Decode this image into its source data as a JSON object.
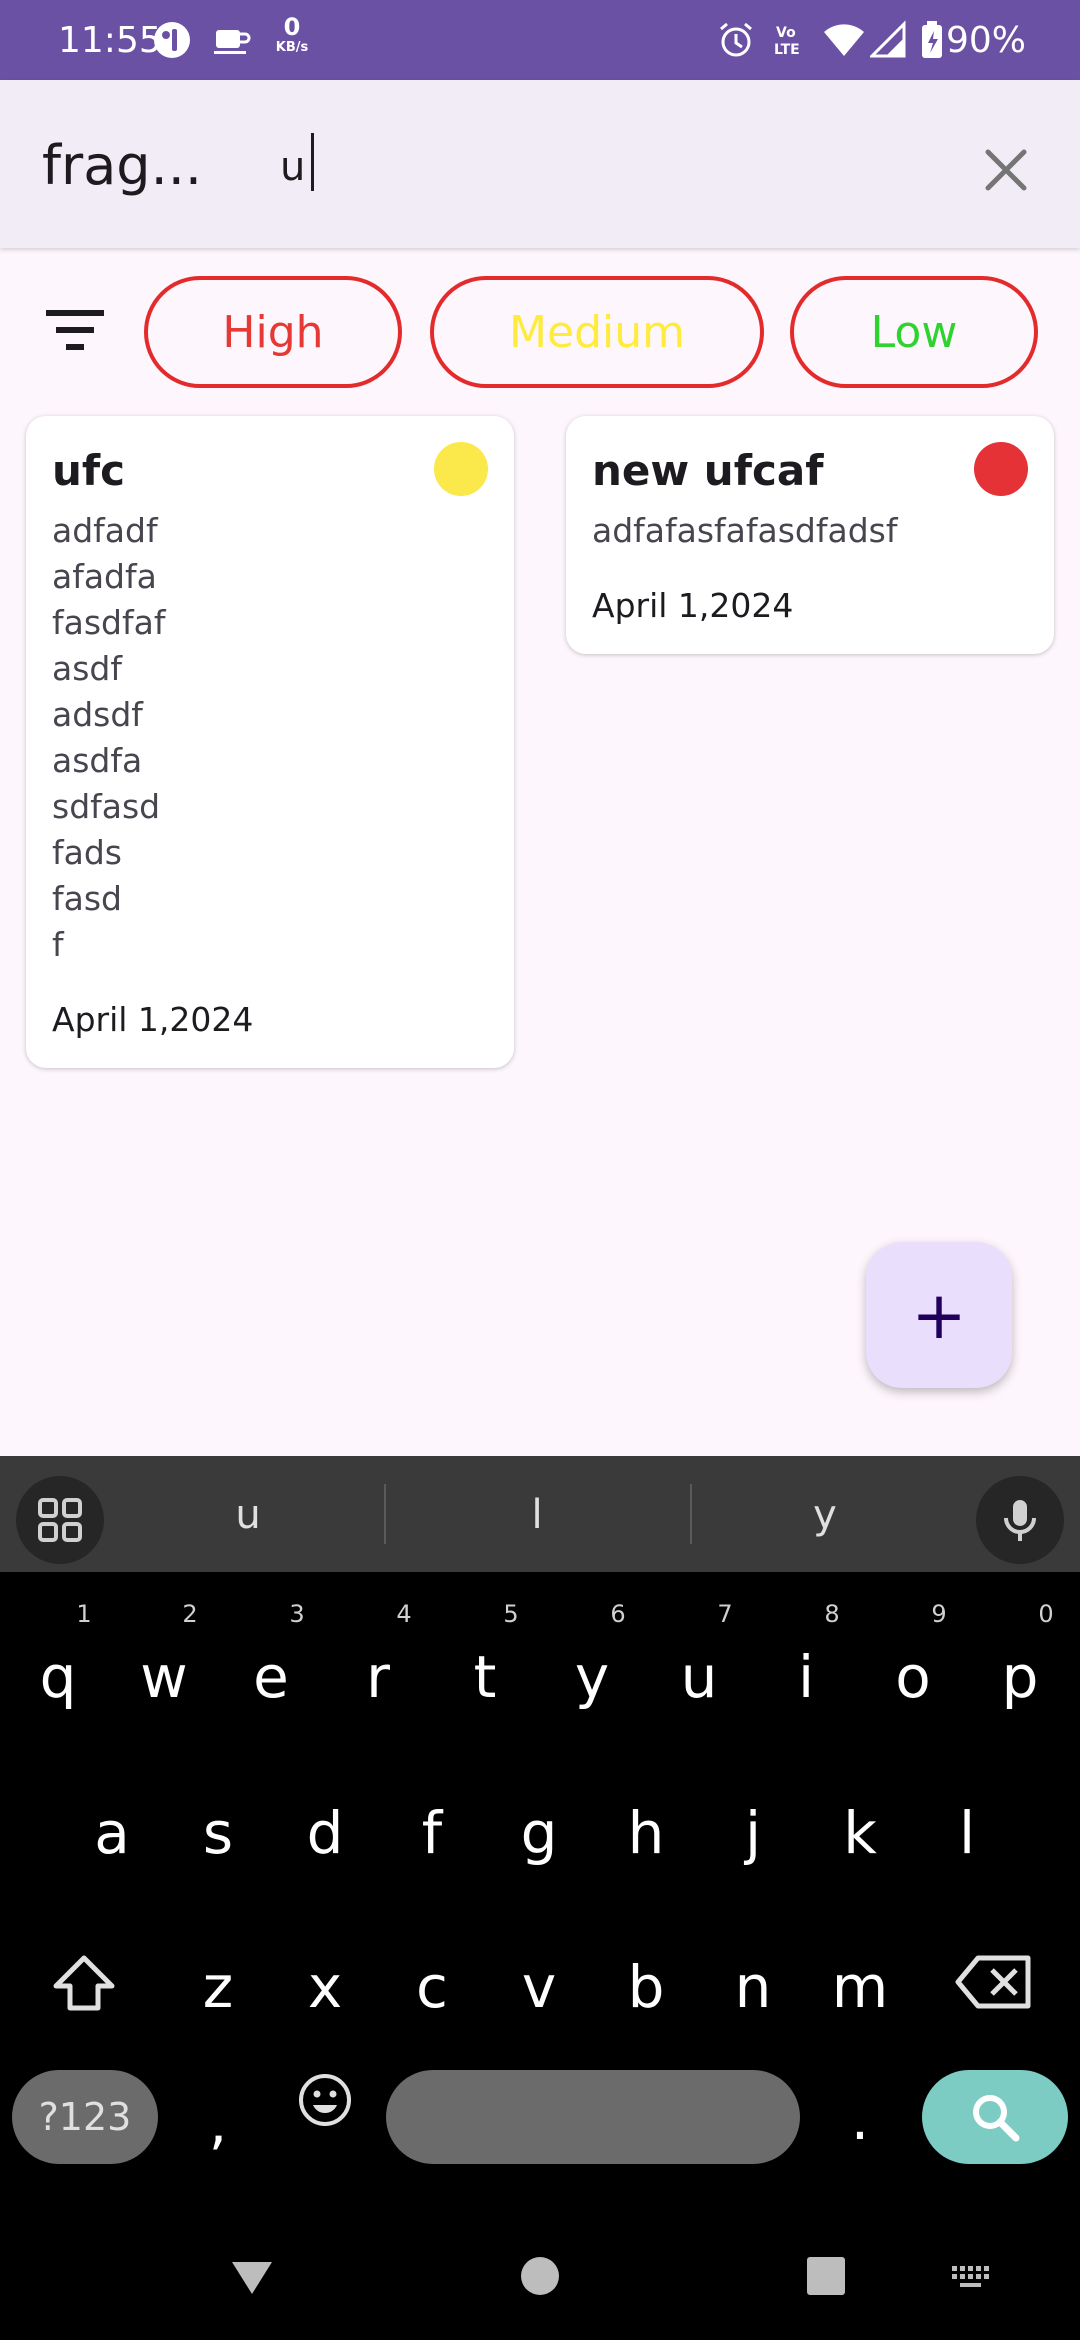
{
  "status_bar": {
    "time": "11:55",
    "net_speed_value": "0",
    "net_speed_unit": "KB/s",
    "battery": "90%",
    "icons": [
      "app-icon",
      "coffee-icon",
      "alarm-icon",
      "volte-icon",
      "wifi-icon",
      "signal-icon",
      "battery-charging-icon"
    ]
  },
  "header": {
    "title_ellipsis": "frag...",
    "search_value": "u",
    "clear_icon": "close-icon"
  },
  "filters": {
    "filter_icon": "filter-list-icon",
    "chips": [
      {
        "label": "High",
        "color": "#e53935"
      },
      {
        "label": "Medium",
        "color": "#ffeb3b"
      },
      {
        "label": "Low",
        "color": "#2fd32f"
      }
    ],
    "chip_border_color": "#e32b2b"
  },
  "notes": [
    {
      "title": "ufc",
      "body": "adfadf\nafadfa\nfasdfaf\nasdf\nadsdf\nasdfa\nsdfasd\nfads\nfasd\nf",
      "date": "April 1,2024",
      "priority_color": "#fbe84a"
    },
    {
      "title": "new ufcaf",
      "body": "adfafasfafasdfadsf",
      "date": "April 1,2024",
      "priority_color": "#e53237"
    }
  ],
  "fab": {
    "label": "+",
    "icon": "add-icon"
  },
  "keyboard": {
    "suggestions": [
      "u",
      "l",
      "y"
    ],
    "row1": [
      "q",
      "w",
      "e",
      "r",
      "t",
      "y",
      "u",
      "i",
      "o",
      "p"
    ],
    "row1_hints": [
      "1",
      "2",
      "3",
      "4",
      "5",
      "6",
      "7",
      "8",
      "9",
      "0"
    ],
    "row2": [
      "a",
      "s",
      "d",
      "f",
      "g",
      "h",
      "j",
      "k",
      "l"
    ],
    "row3": [
      "z",
      "x",
      "c",
      "v",
      "b",
      "n",
      "m"
    ],
    "symbols_label": "?123",
    "comma": ",",
    "period": ".",
    "accent_color": "#7cccc4"
  },
  "nav": {
    "back_icon": "back-triangle-icon",
    "home_icon": "home-circle-icon",
    "recents_icon": "recents-square-icon",
    "keyboard_icon": "keyboard-icon"
  }
}
